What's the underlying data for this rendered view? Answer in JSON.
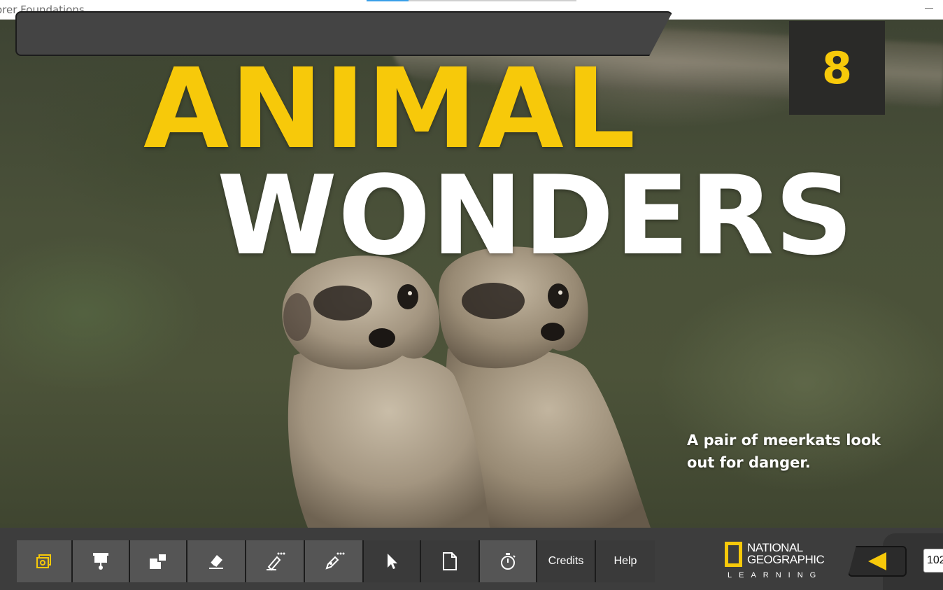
{
  "window": {
    "title": "orer Foundations"
  },
  "page": {
    "title_line1": "ANIMAL",
    "title_line2": "WONDERS",
    "unit_number": "8",
    "caption": "A pair of meerkats look out for danger.",
    "colors": {
      "title_yellow": "#f7c90a",
      "badge_bg": "#2a2a28"
    }
  },
  "toolbar": {
    "tools": [
      {
        "icon": "gallery-icon"
      },
      {
        "icon": "presentation-icon"
      },
      {
        "icon": "zoom-area-icon"
      },
      {
        "icon": "eraser-icon"
      },
      {
        "icon": "pen-icon"
      },
      {
        "icon": "highlighter-icon"
      },
      {
        "icon": "cursor-icon"
      },
      {
        "icon": "page-icon"
      },
      {
        "icon": "timer-icon"
      }
    ],
    "credits_label": "Credits",
    "help_label": "Help"
  },
  "logo": {
    "line1": "NATIONAL",
    "line2": "GEOGRAPHIC",
    "line3": "LEARNING"
  },
  "navigation": {
    "prev_icon": "arrow-left-icon",
    "page_number": "102"
  }
}
